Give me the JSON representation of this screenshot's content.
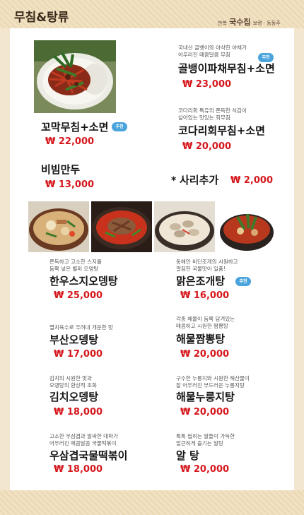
{
  "header": {
    "title": "무침&탕류",
    "brand_prefix": "만복",
    "brand_main": "국수집",
    "brand_suffix": "보령 · 동동주"
  },
  "badge_text": "추천",
  "menu": {
    "golbaengi": {
      "desc": "국내산 골뱅이와 아삭한 야채가\n어우러진 매콤달콤 무침",
      "name": "골뱅이파채무침+소면",
      "price": "₩ 23,000"
    },
    "kkomak": {
      "name": "꼬막무침+소면",
      "price": "₩ 22,000"
    },
    "kodari": {
      "desc": "코다리회 특유의 쫀득한 식감이\n살아있는 맛있는 회무침",
      "name": "코다리회무침+소면",
      "price": "₩ 20,000"
    },
    "bibim": {
      "name": "비빔만두",
      "price": "₩ 13,000"
    },
    "sari": {
      "star": "*",
      "name": "사리추가",
      "price": "₩ 2,000"
    },
    "hanwoo": {
      "desc": "쫀득하고 고소한 스지를\n듬뿍 넣은 별미 오뎅탕",
      "name": "한우스지오뎅탕",
      "price": "₩ 25,000"
    },
    "jogae": {
      "desc": "동해안 비단조개의 시원하고\n깔끔한 국물맛이 일품!",
      "name": "맑은조개탕",
      "price": "₩ 16,000"
    },
    "busan": {
      "desc": "멸치육수로 우려내 개운한 맛",
      "name": "부산오뎅탕",
      "price": "₩ 17,000"
    },
    "jjamppong": {
      "desc": "각종 해물이 듬뿍 담겨있는\n매콤하고 시원한 짬뽕탕",
      "name": "해물짬뽕탕",
      "price": "₩ 20,000"
    },
    "kimchi": {
      "desc": "김치의 시원한 맛과\n오뎅탕의 환상적 조화",
      "name": "김치오뎅탕",
      "price": "₩ 18,000"
    },
    "nurungji": {
      "desc": "구수한 누룽지와 시원한 해산물이\n잘 어우러진 부드러운 누룽지탕",
      "name": "해물누룽지탕",
      "price": "₩ 20,000"
    },
    "tteok": {
      "desc": "고소한 우삼겹과 알싸한 대파가\n어우러진 매콤달콤 국물떡볶이",
      "name": "우삼겹국물떡볶이",
      "price": "₩ 18,000"
    },
    "al": {
      "desc": "톡톡 씹히는 알들이 가득한\n얼큰하게 즐기는 알탕",
      "name": "알 탕",
      "price": "₩ 20,000"
    }
  },
  "colors": {
    "price": "#d5171c",
    "badge": "#4aa4dc",
    "background": "#f3e6cf"
  }
}
